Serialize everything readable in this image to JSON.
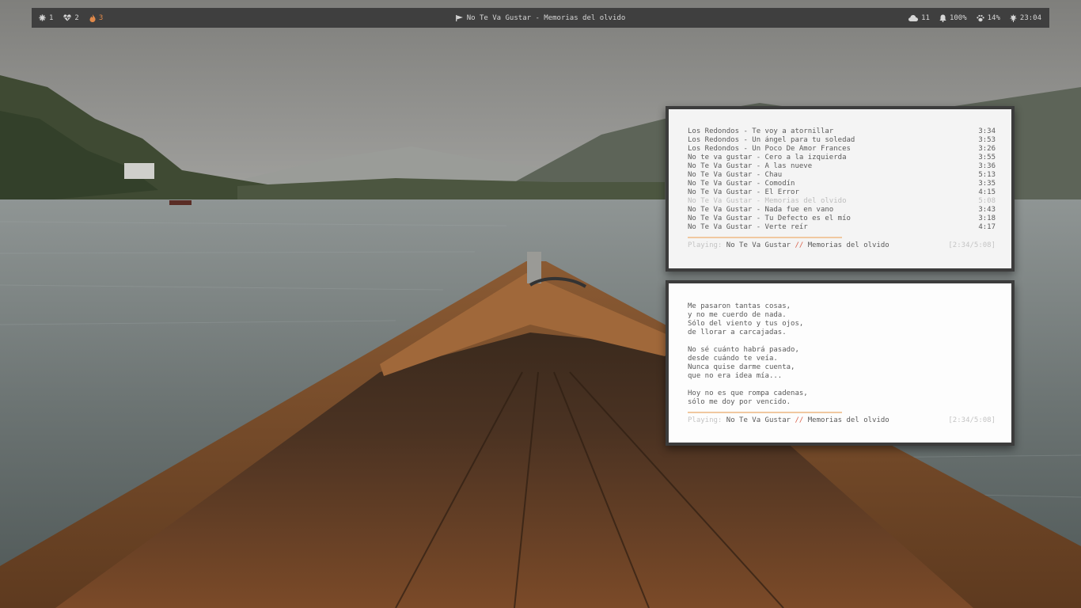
{
  "bar": {
    "workspaces": [
      {
        "icon": "gear-icon",
        "label": "1",
        "active": false
      },
      {
        "icon": "heartbeat-icon",
        "label": "2",
        "active": false
      },
      {
        "icon": "flame-icon",
        "label": "3",
        "active": true
      }
    ],
    "now_playing": "No Te Va Gustar - Memorias del olvido",
    "status": {
      "weather_value": "11",
      "volume_value": "100%",
      "cpu_value": "14%",
      "clock_value": "23:04"
    },
    "accent": "#e0894a"
  },
  "playlist": {
    "tracks": [
      {
        "title": "Los Redondos - Te voy a atornillar",
        "duration": "3:34",
        "current": false
      },
      {
        "title": "Los Redondos - Un ángel para tu soledad",
        "duration": "3:53",
        "current": false
      },
      {
        "title": "Los Redondos - Un Poco De Amor Frances",
        "duration": "3:26",
        "current": false
      },
      {
        "title": "No te va gustar - Cero a la izquierda",
        "duration": "3:55",
        "current": false
      },
      {
        "title": "No Te Va Gustar - A las nueve",
        "duration": "3:36",
        "current": false
      },
      {
        "title": "No Te Va Gustar - Chau",
        "duration": "5:13",
        "current": false
      },
      {
        "title": "No Te Va Gustar - Comodín",
        "duration": "3:35",
        "current": false
      },
      {
        "title": "No Te Va Gustar - El Error",
        "duration": "4:15",
        "current": false
      },
      {
        "title": "No Te Va Gustar - Memorias del olvido",
        "duration": "5:08",
        "current": true
      },
      {
        "title": "No Te Va Gustar - Nada fue en vano",
        "duration": "3:43",
        "current": false
      },
      {
        "title": "No Te Va Gustar - Tu Defecto es el mío",
        "duration": "3:18",
        "current": false
      },
      {
        "title": "No Te Va Gustar - Verte reír",
        "duration": "4:17",
        "current": false
      }
    ],
    "status": {
      "label": "Playing:",
      "artist": "No Te Va Gustar",
      "separator": "//",
      "song": "Memorias del olvido",
      "time": "[2:34/5:08]"
    },
    "progress": 0.5
  },
  "lyrics": {
    "stanzas": [
      [
        "Me pasaron tantas cosas,",
        "y no me cuerdo de nada.",
        "Sólo del viento y tus ojos,",
        "de llorar a carcajadas."
      ],
      [
        "No sé cuánto habrá pasado,",
        "desde cuándo te veía.",
        "Nunca quise darme cuenta,",
        "que no era idea mía..."
      ],
      [
        "Hoy no es que rompa cadenas,",
        "sólo me doy por vencido."
      ]
    ],
    "status": {
      "label": "Playing:",
      "artist": "No Te Va Gustar",
      "separator": "//",
      "song": "Memorias del olvido",
      "time": "[2:34/5:08]"
    },
    "progress": 0.5
  }
}
